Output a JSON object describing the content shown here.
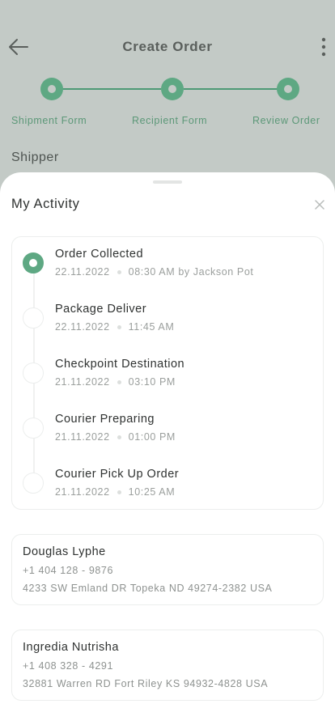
{
  "header": {
    "title": "Create Order",
    "back_icon": "arrow-left-icon",
    "more_icon": "more-vertical-icon"
  },
  "stepper": {
    "steps": [
      {
        "label": "Shipment Form"
      },
      {
        "label": "Recipient Form"
      },
      {
        "label": "Review Order"
      }
    ],
    "accent": "#5ea883"
  },
  "section_label": "Shipper",
  "sheet": {
    "title": "My Activity",
    "close_icon": "close-icon",
    "activities": [
      {
        "title": "Order Collected",
        "date": "22.11.2022",
        "detail": "08:30 AM by Jackson Pot",
        "active": true
      },
      {
        "title": "Package Deliver",
        "date": "22.11.2022",
        "detail": "11:45 AM",
        "active": false
      },
      {
        "title": "Checkpoint Destination",
        "date": "21.11.2022",
        "detail": "03:10 PM",
        "active": false
      },
      {
        "title": "Courier Preparing",
        "date": "21.11.2022",
        "detail": "01:00 PM",
        "active": false
      },
      {
        "title": "Courier Pick Up Order",
        "date": "21.11.2022",
        "detail": "10:25 AM",
        "active": false
      }
    ],
    "contacts": [
      {
        "name": "Douglas Lyphe",
        "phone": "+1 404 128 - 9876",
        "address": "4233 SW Emland DR Topeka ND 49274-2382 USA"
      },
      {
        "name": "Ingredia Nutrisha",
        "phone": "+1 408 328 - 4291",
        "address": "32881 Warren RD Fort Riley KS 94932-4828 USA"
      }
    ]
  }
}
